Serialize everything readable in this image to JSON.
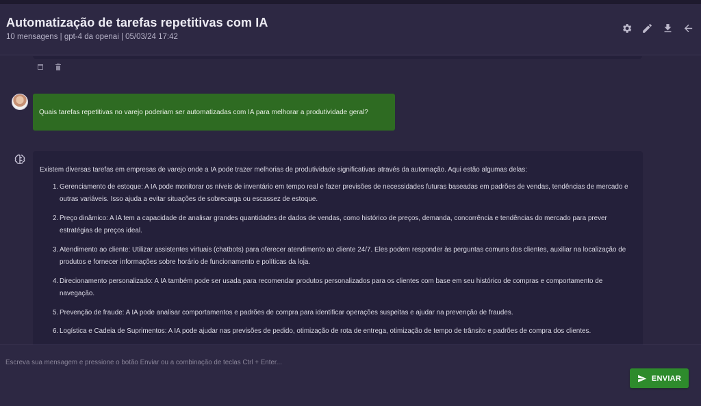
{
  "header": {
    "title": "Automatização de tarefas repetitivas com IA",
    "meta": "10 mensagens | gpt-4 da openai | 05/03/24 17:42",
    "actions": [
      "gear-icon",
      "pencil-icon",
      "download-icon",
      "back-arrow-icon"
    ]
  },
  "messages": {
    "user_message": "Quais tarefas repetitivas no varejo poderiam ser automatizadas com IA para melhorar a produtividade geral?",
    "assistant": {
      "intro": "Existem diversas tarefas em empresas de varejo onde a IA pode trazer melhorias de produtividade significativas através da automação. Aqui estão algumas delas:",
      "items": [
        {
          "num": "1.",
          "text": "Gerenciamento de estoque: A IA pode monitorar os níveis de inventário em tempo real e fazer previsões de necessidades futuras baseadas em padrões de vendas, tendências de mercado e outras variáveis. Isso ajuda a evitar situações de sobrecarga ou escassez de estoque."
        },
        {
          "num": "2.",
          "text": "Preço dinâmico: A IA tem a capacidade de analisar grandes quantidades de dados de vendas, como histórico de preços, demanda, concorrência e tendências do mercado para prever estratégias de preços ideal."
        },
        {
          "num": "3.",
          "text": "Atendimento ao cliente: Utilizar assistentes virtuais (chatbots) para oferecer atendimento ao cliente 24/7. Eles podem responder às perguntas comuns dos clientes, auxiliar na localização de produtos e fornecer informações sobre horário de funcionamento e políticas da loja."
        },
        {
          "num": "4.",
          "text": "Direcionamento personalizado: A IA também pode ser usada para recomendar produtos personalizados para os clientes com base em seu histórico de compras e comportamento de navegação."
        },
        {
          "num": "5.",
          "text": "Prevenção de fraude: A IA pode analisar comportamentos e padrões de compra para identificar operações suspeitas e ajudar na prevenção de fraudes."
        },
        {
          "num": "6.",
          "text": "Logística e Cadeia de Suprimentos: A IA pode ajudar nas previsões de pedido, otimização de rota de entrega, otimização de tempo de trânsito e padrões de compra dos clientes."
        }
      ]
    }
  },
  "composer": {
    "placeholder": "Escreva sua mensagem e pressione o botão Enviar ou a combinação de teclas Ctrl + Enter...",
    "send_label": "ENVIAR"
  },
  "colors": {
    "background": "#2b2640",
    "user_bubble": "#2e6b22",
    "assistant_bubble": "#24203a",
    "send_button": "#2e8b2c"
  }
}
